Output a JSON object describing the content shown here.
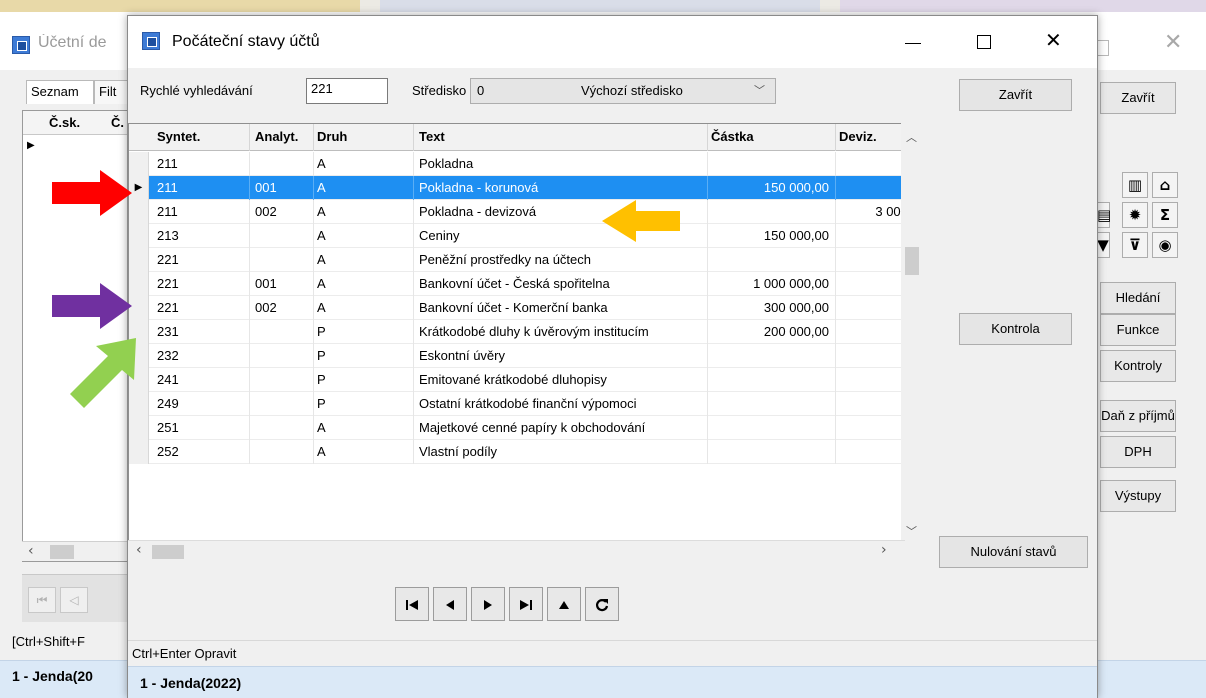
{
  "background_window": {
    "title": "Účetní de",
    "tabs": [
      "Seznam",
      "Filt"
    ],
    "grid_columns": [
      "Č.sk.",
      "Č."
    ],
    "status_hint": "[Ctrl+Shift+F",
    "user": "1 - Jenda(20",
    "close_button": "Zavřít",
    "buttons": {
      "hledani": "Hledání",
      "funkce": "Funkce",
      "kontroly": "Kontroly",
      "dan": "Daň z příjmů",
      "dph": "DPH",
      "vystupy": "Výstupy"
    },
    "icons": [
      "chart-icon",
      "bank-icon",
      "document-icon",
      "gear-icon",
      "sum-icon",
      "filter-icon",
      "clear-filter-icon",
      "eye-icon"
    ]
  },
  "dialog": {
    "title": "Počáteční stavy účtů",
    "quick_search_label": "Rychlé vyhledávání",
    "quick_search_value": "221",
    "stredisko_label": "Středisko",
    "stredisko_code": "0",
    "stredisko_name": "Výchozí středisko",
    "close_button": "Zavřít",
    "kontrola_button": "Kontrola",
    "nulovani_button": "Nulování stavů",
    "columns": [
      "Syntet.",
      "Analyt.",
      "Druh",
      "Text",
      "Částka",
      "Deviz."
    ],
    "rows": [
      {
        "syntet": "211",
        "analyt": "",
        "druh": "A",
        "text": "Pokladna",
        "castka": "",
        "deviz": ""
      },
      {
        "syntet": "211",
        "analyt": "001",
        "druh": "A",
        "text": "Pokladna - korunová",
        "castka": "150 000,00",
        "deviz": "",
        "selected": true
      },
      {
        "syntet": "211",
        "analyt": "002",
        "druh": "A",
        "text": "Pokladna - devizová",
        "castka": "",
        "deviz": "3 00("
      },
      {
        "syntet": "213",
        "analyt": "",
        "druh": "A",
        "text": "Ceniny",
        "castka": "150 000,00",
        "deviz": ""
      },
      {
        "syntet": "221",
        "analyt": "",
        "druh": "A",
        "text": "Peněžní prostředky na účtech",
        "castka": "",
        "deviz": ""
      },
      {
        "syntet": "221",
        "analyt": "001",
        "druh": "A",
        "text": "Bankovní účet - Česká spořitelna",
        "castka": "1 000 000,00",
        "deviz": ""
      },
      {
        "syntet": "221",
        "analyt": "002",
        "druh": "A",
        "text": "Bankovní účet - Komerční banka",
        "castka": "300 000,00",
        "deviz": ""
      },
      {
        "syntet": "231",
        "analyt": "",
        "druh": "P",
        "text": "Krátkodobé dluhy k úvěrovým institucím",
        "castka": "200 000,00",
        "deviz": ""
      },
      {
        "syntet": "232",
        "analyt": "",
        "druh": "P",
        "text": "Eskontní úvěry",
        "castka": "",
        "deviz": ""
      },
      {
        "syntet": "241",
        "analyt": "",
        "druh": "P",
        "text": "Emitované krátkodobé dluhopisy",
        "castka": "",
        "deviz": ""
      },
      {
        "syntet": "249",
        "analyt": "",
        "druh": "P",
        "text": "Ostatní krátkodobé finanční výpomoci",
        "castka": "",
        "deviz": ""
      },
      {
        "syntet": "251",
        "analyt": "",
        "druh": "A",
        "text": "Majetkové cenné papíry k obchodování",
        "castka": "",
        "deviz": ""
      },
      {
        "syntet": "252",
        "analyt": "",
        "druh": "A",
        "text": "Vlastní podíly",
        "castka": "",
        "deviz": ""
      }
    ],
    "nav_icons": [
      "first-record-icon",
      "prev-record-icon",
      "next-record-icon",
      "last-record-icon",
      "up-icon",
      "refresh-icon"
    ],
    "status_hint": "Ctrl+Enter Opravit",
    "user": "1 - Jenda(2022)"
  },
  "annotations": [
    {
      "name": "red-arrow",
      "color": "#ff0000"
    },
    {
      "name": "orange-arrow",
      "color": "#ffc000"
    },
    {
      "name": "purple-arrow",
      "color": "#7030a0"
    },
    {
      "name": "green-arrow",
      "color": "#92d050"
    }
  ],
  "colors": {
    "selection": "#1e8ff2",
    "status_bar": "#dbe9f7"
  }
}
